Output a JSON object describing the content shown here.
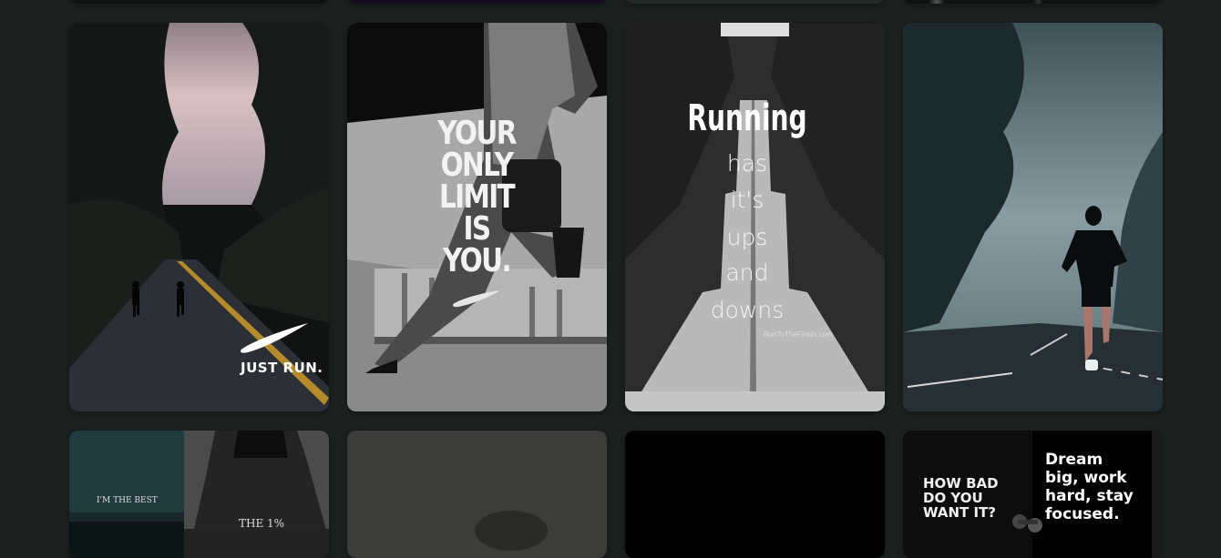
{
  "gallery": {
    "tiles": [
      {
        "name": "Nike just run poster",
        "overlay": {
          "brand_mark": "swoosh-logo",
          "text": "JUST RUN."
        }
      },
      {
        "name": "Your only limit is you poster",
        "overlay": {
          "lines": [
            "YOUR",
            "ONLY",
            "LIMIT",
            "IS",
            "YOU."
          ],
          "brand_mark": "swoosh-logo"
        }
      },
      {
        "name": "Running ups and downs poster",
        "overlay": {
          "title": "Running",
          "lines": [
            "has",
            "it's",
            "ups",
            "and",
            "downs"
          ],
          "credit": "RunToTheFinish.com"
        }
      },
      {
        "name": "Foggy road runner photo"
      }
    ],
    "bottom_tiles": [
      {
        "name": "I'm the best vs the 1% poster",
        "overlay": {
          "left_text": "I'M THE BEST",
          "right_text": "THE 1%"
        }
      },
      {
        "name": "Dark runner photo"
      },
      {
        "name": "Black poster"
      },
      {
        "name": "How bad do you want it poster",
        "overlay": {
          "left_lines": [
            "HOW BAD",
            "DO YOU",
            "WANT IT?"
          ],
          "right_lines": [
            "Dream",
            "big, work",
            "hard, stay",
            "focused."
          ]
        }
      }
    ]
  },
  "colors": {
    "background": "#1c211f",
    "text": "#ffffff"
  }
}
